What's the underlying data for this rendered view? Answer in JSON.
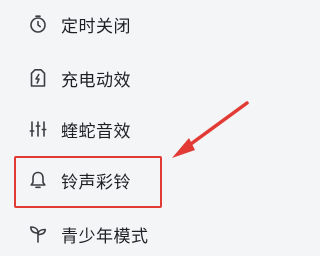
{
  "menu": {
    "items": [
      {
        "label": "定时关闭",
        "icon": "timer-icon"
      },
      {
        "label": "充电动效",
        "icon": "charging-animation-icon"
      },
      {
        "label": "蝰蛇音效",
        "icon": "equalizer-icon"
      },
      {
        "label": "铃声彩铃",
        "icon": "bell-icon"
      },
      {
        "label": "青少年模式",
        "icon": "sprout-icon"
      }
    ]
  },
  "annotation": {
    "highlighted_item": "铃声彩铃",
    "color": "#e23b35"
  },
  "colors": {
    "background": "#f4f5f7",
    "text": "#1f2026",
    "icon": "#3c3e44"
  }
}
